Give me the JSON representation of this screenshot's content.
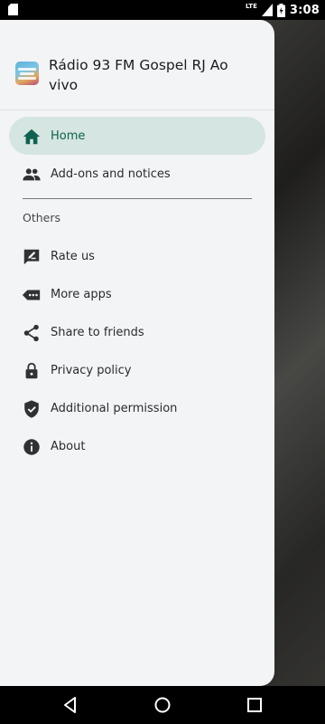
{
  "status_bar": {
    "network": "LTE",
    "time": "3:08"
  },
  "drawer": {
    "app_title": "Rádio 93 FM Gospel RJ Ao vivo",
    "primary_items": [
      {
        "label": "Home",
        "icon": "home-icon",
        "active": true
      },
      {
        "label": "Add-ons and notices",
        "icon": "people-icon",
        "active": false
      }
    ],
    "section_label": "Others",
    "secondary_items": [
      {
        "label": "Rate us",
        "icon": "rate-icon"
      },
      {
        "label": "More apps",
        "icon": "more-apps-icon"
      },
      {
        "label": "Share to friends",
        "icon": "share-icon"
      },
      {
        "label": "Privacy policy",
        "icon": "lock-icon"
      },
      {
        "label": "Additional permission",
        "icon": "shield-check-icon"
      },
      {
        "label": "About",
        "icon": "info-icon"
      }
    ]
  },
  "colors": {
    "active_background": "#d5e5e1",
    "active_accent": "#10614f",
    "drawer_background": "#f3f4f6"
  },
  "system_nav": [
    "back-button",
    "home-button",
    "recents-button"
  ]
}
